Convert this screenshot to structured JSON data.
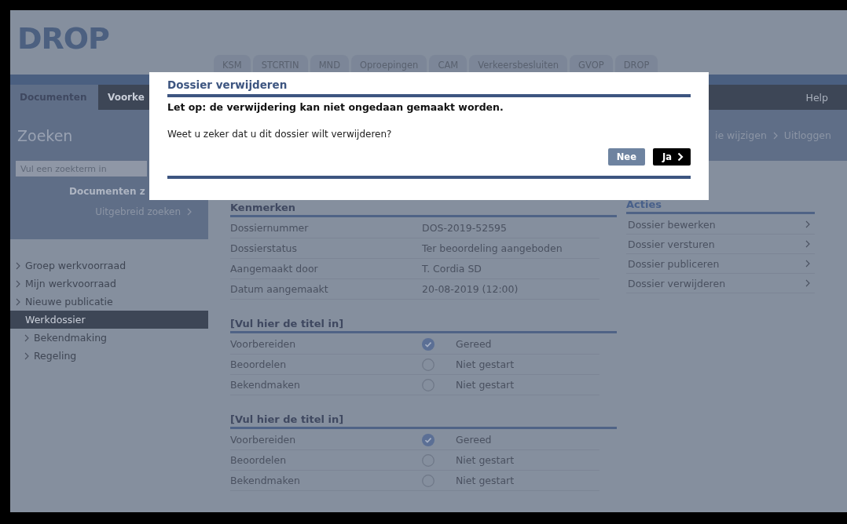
{
  "logo": "DROP",
  "tabs": [
    {
      "label": "KSM",
      "selected": false
    },
    {
      "label": "STCRTIN",
      "selected": false
    },
    {
      "label": "MND",
      "selected": false
    },
    {
      "label": "Oproepingen",
      "selected": false
    },
    {
      "label": "CAM",
      "selected": false
    },
    {
      "label": "Verkeersbesluiten",
      "selected": false
    },
    {
      "label": "GVOP",
      "selected": false
    },
    {
      "label": "DROP",
      "selected": false
    }
  ],
  "nav": [
    {
      "label": "Documenten",
      "selected": true
    },
    {
      "label": "Voorke",
      "selected": false
    }
  ],
  "help": "Help",
  "user_links": [
    "ie wijzigen",
    "Uitloggen"
  ],
  "search": {
    "title": "Zoeken",
    "placeholder": "Vul een zoekterm in",
    "button": "Documenten z",
    "advanced": "Uitgebreid zoeken"
  },
  "sidebar": [
    {
      "label": "Groep werkvoorraad",
      "selected": false
    },
    {
      "label": "Mijn werkvoorraad",
      "selected": false
    },
    {
      "label": "Nieuwe publicatie",
      "selected": false
    },
    {
      "label": "Werkdossier",
      "selected": true,
      "children": [
        {
          "label": "Bekendmaking",
          "selected": false
        },
        {
          "label": "Regeling",
          "selected": false
        }
      ]
    }
  ],
  "kenmerken": {
    "title": "Kenmerken",
    "rows": [
      {
        "label": "Dossiernummer",
        "value": "DOS-2019-52595"
      },
      {
        "label": "Dossierstatus",
        "value": "Ter beoordeling aangeboden"
      },
      {
        "label": "Aangemaakt door",
        "value": "T. Cordia SD"
      },
      {
        "label": "Datum aangemaakt",
        "value": "20-08-2019 (12:00)"
      }
    ]
  },
  "sections": [
    {
      "title": "[Vul hier de titel in]",
      "steps": [
        {
          "label": "Voorbereiden",
          "done": true,
          "status": "Gereed"
        },
        {
          "label": "Beoordelen",
          "done": false,
          "status": "Niet gestart"
        },
        {
          "label": "Bekendmaken",
          "done": false,
          "status": "Niet gestart"
        }
      ]
    },
    {
      "title": "[Vul hier de titel in]",
      "steps": [
        {
          "label": "Voorbereiden",
          "done": true,
          "status": "Gereed"
        },
        {
          "label": "Beoordelen",
          "done": false,
          "status": "Niet gestart"
        },
        {
          "label": "Bekendmaken",
          "done": false,
          "status": "Niet gestart"
        }
      ]
    }
  ],
  "actions": {
    "title": "Acties",
    "items": [
      "Dossier bewerken",
      "Dossier versturen",
      "Dossier publiceren",
      "Dossier verwijderen"
    ]
  },
  "dialog": {
    "title": "Dossier verwijderen",
    "warning": "Let op: de verwijdering kan niet ongedaan gemaakt worden.",
    "question": "Weet u zeker dat u dit dossier wilt verwijderen?",
    "buttons": [
      {
        "label": "Nee",
        "kind": "secondary"
      },
      {
        "label": "Ja",
        "kind": "primary"
      }
    ]
  }
}
